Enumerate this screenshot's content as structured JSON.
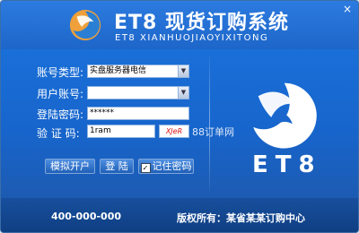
{
  "window": {
    "close_label": "×"
  },
  "header": {
    "title": "ET8  现货订购系统",
    "subtitle": "ET8  XIANHUOJIAOYIXITONG"
  },
  "form": {
    "account_type_label": "账号类型:",
    "account_type_value": "实盘服务器电信",
    "user_account_label": "用户账号:",
    "user_account_value": "",
    "password_label": "登陆密码:",
    "password_value": "******",
    "captcha_label": "验 证 码:",
    "captcha_value": "1ram",
    "captcha_image_text": "XJeR",
    "watermark": "88订单网"
  },
  "buttons": {
    "simulate": "模拟开户",
    "login": "登 陆",
    "remember": "记住密码"
  },
  "brand": {
    "logo_text": "ET8"
  },
  "footer": {
    "phone": "400-000-000",
    "copyright": "版权所有：某省某某订购中心"
  },
  "colors": {
    "primary_blue": "#1a66cc",
    "dark_blue": "#103f82"
  }
}
